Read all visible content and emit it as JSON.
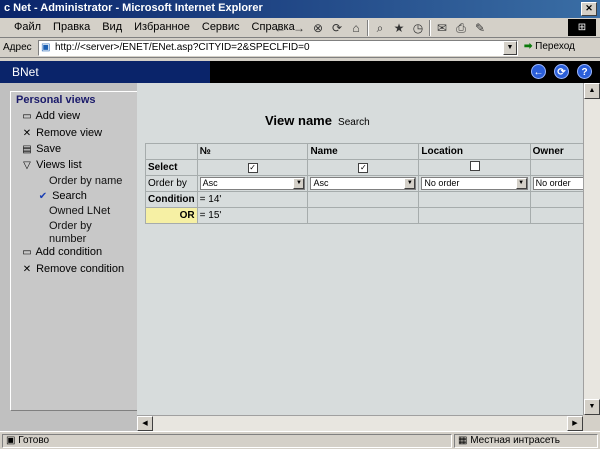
{
  "window": {
    "title": "c Net - Administrator - Microsoft Internet Explorer"
  },
  "menu": {
    "items": [
      "Файл",
      "Правка",
      "Вид",
      "Избранное",
      "Сервис",
      "Справка"
    ]
  },
  "address": {
    "label": "Адрес",
    "url": "http://<server>/ENET/ENet.asp?CITYID=2&SPECLFID=0",
    "go_label": "Переход"
  },
  "app": {
    "brand": "BNet"
  },
  "sidebar": {
    "heading": "Personal views",
    "items": {
      "add_view": "Add view",
      "remove_view": "Remove view",
      "save": "Save",
      "views_list": "Views list",
      "order_by_name": "Order by name",
      "search": "Search",
      "owned_lnet": "Owned LNet",
      "order_by_number": "Order by number",
      "add_condition": "Add condition",
      "remove_condition": "Remove condition"
    }
  },
  "view": {
    "name_label": "View name",
    "name_value": "Search"
  },
  "grid": {
    "columns": [
      "№",
      "Name",
      "Location",
      "Owner"
    ],
    "select_label": "Select",
    "select_checked": [
      true,
      true,
      false,
      false
    ],
    "orderby_label": "Order by",
    "orderby_values": [
      "Asc",
      "Asc",
      "No order",
      "No order"
    ],
    "condition_label": "Condition",
    "condition_values": [
      "= 14'",
      "",
      "",
      ""
    ],
    "or_label": "OR",
    "or_values": [
      "= 15'",
      "",
      "",
      ""
    ]
  },
  "status": {
    "text": "Готово",
    "zone": "Местная интрасеть"
  }
}
